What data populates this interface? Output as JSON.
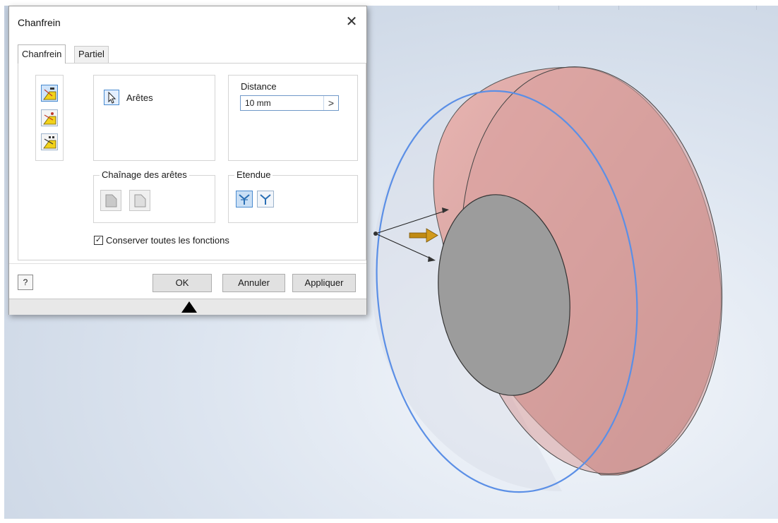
{
  "dialog": {
    "title": "Chanfrein",
    "close_glyph": "✕",
    "tabs": [
      {
        "label": "Chanfrein",
        "active": true
      },
      {
        "label": "Partiel",
        "active": false
      }
    ],
    "edges_label": "Arêtes",
    "distance": {
      "label": "Distance",
      "value": "10 mm",
      "arrow_glyph": ">"
    },
    "edge_chain": {
      "label": "Chaînage des arêtes"
    },
    "extent": {
      "label": "Etendue"
    },
    "preserve_features": {
      "label": "Conserver toutes les fonctions",
      "checked": true,
      "check_glyph": "✓"
    },
    "help_glyph": "?",
    "buttons": {
      "ok": "OK",
      "cancel": "Annuler",
      "apply": "Appliquer"
    }
  },
  "colors": {
    "accent": "#4a8bd0",
    "part_face": "#e3a9a6",
    "inner_face": "#9b9b9b",
    "selection_circle": "#5b8fe6",
    "arrow_gold": "#c08a12"
  },
  "icons": {
    "mode_buttons": [
      "chamfer-distance-icon",
      "chamfer-distance-angle-icon",
      "chamfer-two-distances-icon"
    ],
    "select": "cursor-arrow-icon",
    "chain_buttons": [
      "all-edges-icon",
      "single-edge-icon"
    ],
    "extent_buttons": [
      "setback-icon",
      "no-setback-icon"
    ]
  }
}
